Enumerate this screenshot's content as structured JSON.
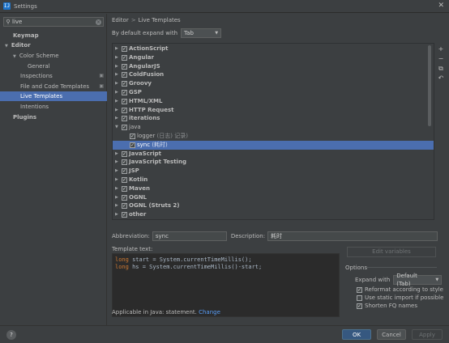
{
  "window": {
    "title": "Settings"
  },
  "search": {
    "value": "live"
  },
  "sidebar": {
    "items": [
      {
        "label": "Keymap"
      },
      {
        "label": "Editor"
      },
      {
        "label": "Color Scheme"
      },
      {
        "label": "General"
      },
      {
        "label": "Inspections"
      },
      {
        "label": "File and Code Templates"
      },
      {
        "label": "Live Templates"
      },
      {
        "label": "Intentions"
      },
      {
        "label": "Plugins"
      }
    ]
  },
  "breadcrumb": {
    "parent": "Editor",
    "separator": ">",
    "current": "Live Templates"
  },
  "expand": {
    "label": "By default expand with",
    "value": "Tab"
  },
  "template_groups": [
    {
      "label": "ActionScript"
    },
    {
      "label": "Angular"
    },
    {
      "label": "AngularJS"
    },
    {
      "label": "ColdFusion"
    },
    {
      "label": "Groovy"
    },
    {
      "label": "GSP"
    },
    {
      "label": "HTML/XML"
    },
    {
      "label": "HTTP Request"
    },
    {
      "label": "iterations"
    },
    {
      "label": "java"
    },
    {
      "label": "logger",
      "desc": "(日志) 记录)"
    },
    {
      "label": "sync",
      "desc": "(耗时)"
    },
    {
      "label": "JavaScript"
    },
    {
      "label": "JavaScript Testing"
    },
    {
      "label": "JSP"
    },
    {
      "label": "Kotlin"
    },
    {
      "label": "Maven"
    },
    {
      "label": "OGNL"
    },
    {
      "label": "OGNL (Struts 2)"
    },
    {
      "label": "other"
    }
  ],
  "tools": {
    "add": "+",
    "remove": "−",
    "copy": "⧉",
    "restore": "↶"
  },
  "abbreviation": {
    "label": "Abbreviation:",
    "value": "sync"
  },
  "description": {
    "label": "Description:",
    "value": "耗时"
  },
  "template_text": {
    "label": "Template text:",
    "line1_kw": "long",
    "line1_rest": " start = System.currentTimeMillis();",
    "line2_kw": "long",
    "line2_rest": " hs = System.currentTimeMillis()-start;"
  },
  "edit_variables": {
    "label": "Edit variables"
  },
  "options": {
    "title": "Options",
    "expand_label": "Expand with",
    "expand_value": "Default (Tab)",
    "reformat": "Reformat according to style",
    "static_import": "Use static import if possible",
    "shorten_fq": "Shorten FQ names"
  },
  "applicable": {
    "text": "Applicable in Java: statement.",
    "link": "Change"
  },
  "footer": {
    "help": "?",
    "ok": "OK",
    "cancel": "Cancel",
    "apply": "Apply"
  }
}
